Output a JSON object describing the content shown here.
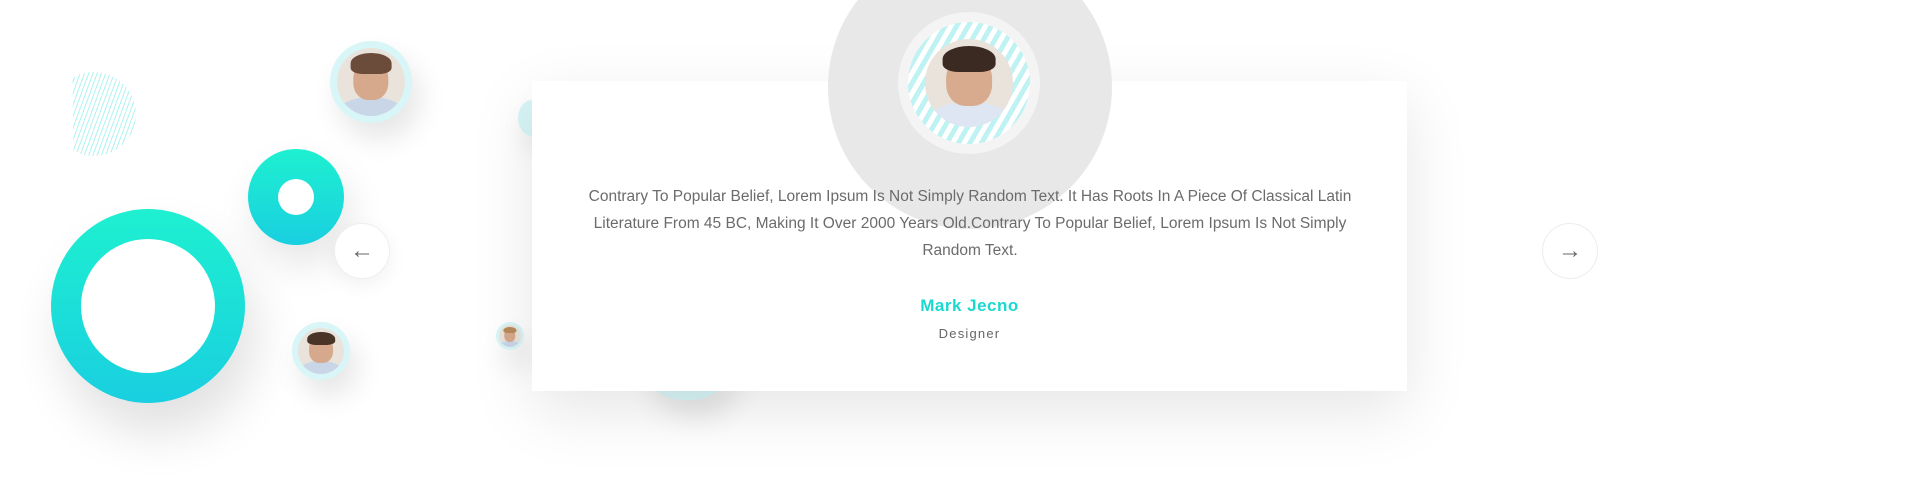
{
  "testimonial": {
    "quote": "Contrary To Popular Belief, Lorem Ipsum Is Not Simply Random Text. It Has Roots In A Piece Of Classical Latin Literature From 45 BC, Making It Over 2000 Years Old.Contrary To Popular Belief, Lorem Ipsum Is Not Simply Random Text.",
    "name": "Mark Jecno",
    "role": "Designer"
  },
  "nav": {
    "prev_icon": "arrow-left-icon",
    "next_icon": "arrow-right-icon",
    "prev_glyph": "←",
    "next_glyph": "→"
  },
  "colors": {
    "accent": "#1ad9cf",
    "ring_gradient_top": "#1ef0d0",
    "ring_gradient_bottom": "#19cfe0",
    "text": "#6b6b6b"
  }
}
